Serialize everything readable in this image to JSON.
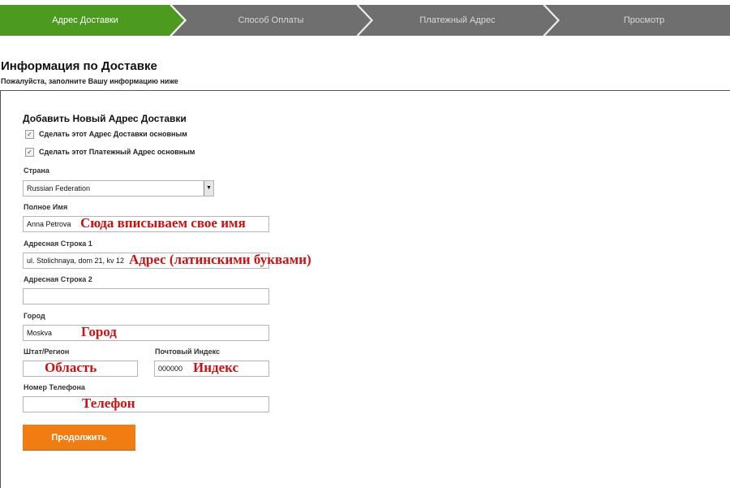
{
  "steps": [
    {
      "label": "Адрес Доставки",
      "active": true
    },
    {
      "label": "Способ Оплаты",
      "active": false
    },
    {
      "label": "Платежный Адрес",
      "active": false
    },
    {
      "label": "Просмотр",
      "active": false
    }
  ],
  "colors": {
    "step_active": "#4c9a1f",
    "step_inactive": "#6f6f6f",
    "annotation": "#cc1111",
    "button": "#f07c12"
  },
  "header": {
    "title": "Информация по Доставке",
    "subtitle": "Пожалуйста, заполните Вашу информацию ниже"
  },
  "form": {
    "section_title": "Добавить Новый Адрес Доставки",
    "checkboxes": [
      {
        "label": "Сделать этот Адрес Доставки основным",
        "checked": true,
        "mark": "✓"
      },
      {
        "label": "Сделать этот Платежный Адрес основным",
        "checked": true,
        "mark": "✓"
      }
    ],
    "country": {
      "label": "Страна",
      "value": "Russian Federation",
      "arrow": "▼"
    },
    "full_name": {
      "label": "Полное Имя",
      "value": "Anna Petrova"
    },
    "address1": {
      "label": "Адресная Строка 1",
      "value": "ul. Stolichnaya, dom 21, kv 12"
    },
    "address2": {
      "label": "Адресная Строка 2",
      "value": ""
    },
    "city": {
      "label": "Город",
      "value": "Moskva"
    },
    "state": {
      "label": "Штат/Регион",
      "value": ""
    },
    "postcode": {
      "label": "Почтовый Индекс",
      "value": "000000"
    },
    "phone": {
      "label": "Номер Телефона",
      "value": ""
    },
    "continue_label": "Продолжить"
  },
  "annotations": {
    "name": "Сюда вписываем свое имя",
    "address": "Адрес (латинскими буквами)",
    "city": "Город",
    "state": "Область",
    "postcode": "Индекс",
    "phone": "Телефон"
  }
}
